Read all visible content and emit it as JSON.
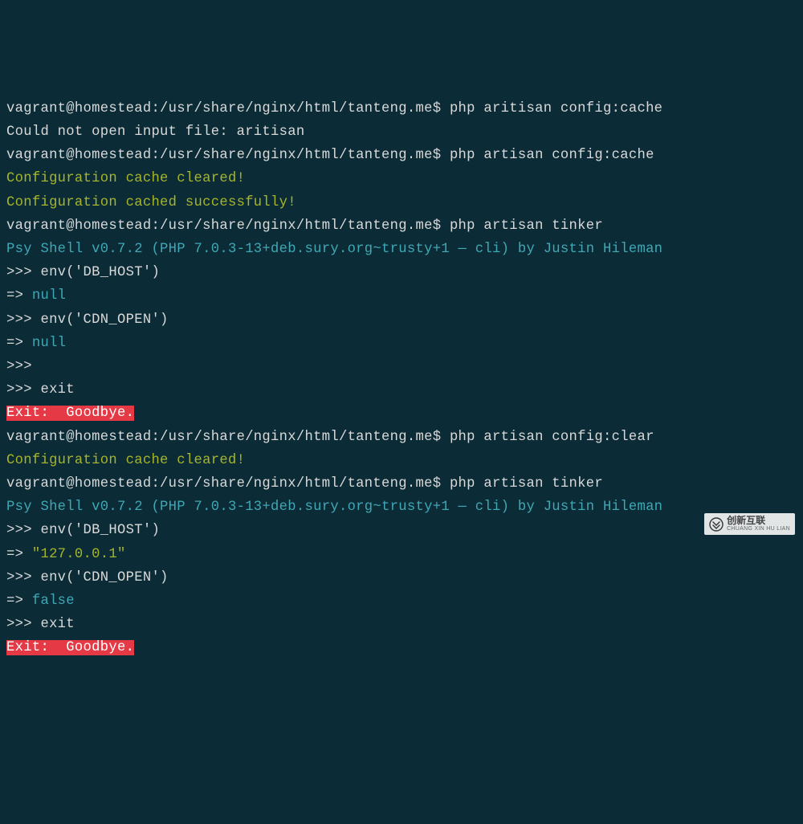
{
  "lines": [
    {
      "segments": [
        {
          "class": "prompt",
          "key": "p1"
        },
        {
          "class": "cmd",
          "key": "c1"
        }
      ]
    },
    {
      "segments": [
        {
          "class": "err",
          "key": "e1"
        }
      ]
    },
    {
      "segments": [
        {
          "class": "prompt",
          "key": "p2"
        },
        {
          "class": "cmd",
          "key": "c2"
        }
      ]
    },
    {
      "segments": [
        {
          "class": "green",
          "key": "g1"
        }
      ]
    },
    {
      "segments": [
        {
          "class": "green",
          "key": "g2"
        }
      ]
    },
    {
      "segments": [
        {
          "class": "prompt",
          "key": "p3"
        },
        {
          "class": "cmd",
          "key": "c3"
        }
      ]
    },
    {
      "segments": [
        {
          "class": "cyan",
          "key": "b1"
        }
      ]
    },
    {
      "segments": [
        {
          "class": "repl",
          "key": "r1"
        }
      ]
    },
    {
      "segments": [
        {
          "class": "arrow",
          "key": "a1"
        },
        {
          "class": "keyword",
          "key": "k1"
        }
      ]
    },
    {
      "segments": [
        {
          "class": "repl",
          "key": "r2"
        }
      ]
    },
    {
      "segments": [
        {
          "class": "arrow",
          "key": "a2"
        },
        {
          "class": "keyword",
          "key": "k2"
        }
      ]
    },
    {
      "segments": [
        {
          "class": "repl",
          "key": "r3"
        }
      ]
    },
    {
      "segments": [
        {
          "class": "repl",
          "key": "r4"
        }
      ]
    },
    {
      "segments": [
        {
          "class": "exit-bg",
          "key": "x1"
        }
      ]
    },
    {
      "segments": [
        {
          "class": "prompt",
          "key": "p4"
        },
        {
          "class": "cmd",
          "key": "c4"
        }
      ]
    },
    {
      "segments": [
        {
          "class": "green",
          "key": "g3"
        }
      ]
    },
    {
      "segments": [
        {
          "class": "prompt",
          "key": "p5"
        },
        {
          "class": "cmd",
          "key": "c5"
        }
      ]
    },
    {
      "segments": [
        {
          "class": "cyan",
          "key": "b2"
        }
      ]
    },
    {
      "segments": [
        {
          "class": "repl",
          "key": "r5"
        }
      ]
    },
    {
      "segments": [
        {
          "class": "arrow",
          "key": "a3"
        },
        {
          "class": "string",
          "key": "s1"
        }
      ]
    },
    {
      "segments": [
        {
          "class": "repl",
          "key": "r6"
        }
      ]
    },
    {
      "segments": [
        {
          "class": "arrow",
          "key": "a4"
        },
        {
          "class": "keyword",
          "key": "k3"
        }
      ]
    },
    {
      "segments": [
        {
          "class": "repl",
          "key": "r7"
        }
      ]
    },
    {
      "segments": [
        {
          "class": "exit-bg",
          "key": "x2"
        }
      ]
    }
  ],
  "text": {
    "p1": "vagrant@homestead:/usr/share/nginx/html/tanteng.me$ ",
    "c1": "php aritisan config:cache",
    "e1": "Could not open input file: aritisan",
    "p2": "vagrant@homestead:/usr/share/nginx/html/tanteng.me$ ",
    "c2": "php artisan config:cache",
    "g1": "Configuration cache cleared!",
    "g2": "Configuration cached successfully!",
    "p3": "vagrant@homestead:/usr/share/nginx/html/tanteng.me$ ",
    "c3": "php artisan tinker",
    "b1": "Psy Shell v0.7.2 (PHP 7.0.3-13+deb.sury.org~trusty+1 — cli) by Justin Hileman",
    "r1": ">>> env('DB_HOST')",
    "a1": "=> ",
    "k1": "null",
    "r2": ">>> env('CDN_OPEN')",
    "a2": "=> ",
    "k2": "null",
    "r3": ">>>",
    "r4": ">>> exit",
    "x1": "Exit:  Goodbye.",
    "p4": "vagrant@homestead:/usr/share/nginx/html/tanteng.me$ ",
    "c4": "php artisan config:clear",
    "g3": "Configuration cache cleared!",
    "p5": "vagrant@homestead:/usr/share/nginx/html/tanteng.me$ ",
    "c5": "php artisan tinker",
    "b2": "Psy Shell v0.7.2 (PHP 7.0.3-13+deb.sury.org~trusty+1 — cli) by Justin Hileman",
    "r5": ">>> env('DB_HOST')",
    "a3": "=> ",
    "s1": "\"127.0.0.1\"",
    "r6": ">>> env('CDN_OPEN')",
    "a4": "=> ",
    "k3": "false",
    "r7": ">>> exit",
    "x2": "Exit:  Goodbye."
  },
  "watermark": {
    "cn": "创新互联",
    "en": "CHUANG XIN HU LIAN"
  }
}
